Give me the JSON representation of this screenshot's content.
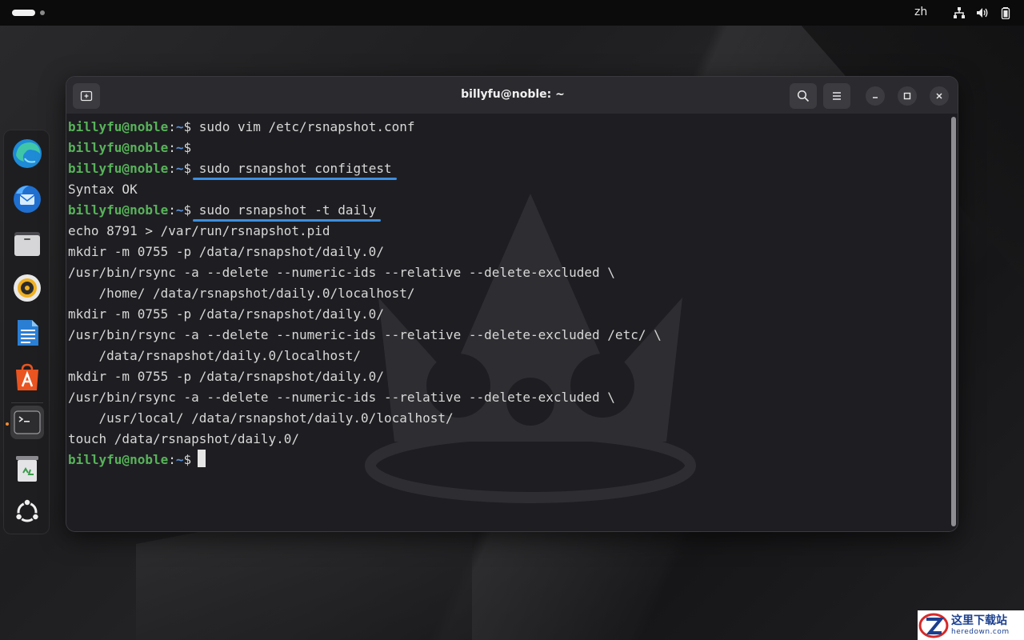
{
  "topbar": {
    "language": "zh",
    "icons": [
      "network-icon",
      "volume-icon",
      "battery-icon"
    ]
  },
  "dock": {
    "items": [
      {
        "name": "edge",
        "icon": "edge-browser-icon"
      },
      {
        "name": "thunderbird",
        "icon": "thunderbird-icon"
      },
      {
        "name": "files",
        "icon": "files-icon"
      },
      {
        "name": "rhythmbox",
        "icon": "rhythmbox-icon"
      },
      {
        "name": "writer",
        "icon": "libreoffice-writer-icon"
      },
      {
        "name": "app-center",
        "icon": "app-center-icon"
      },
      {
        "name": "terminal",
        "icon": "terminal-icon",
        "active": true
      },
      {
        "name": "trash",
        "icon": "trash-icon"
      },
      {
        "name": "show-apps",
        "icon": "ubuntu-logo-icon"
      }
    ]
  },
  "window": {
    "title": "billyfu@noble: ~",
    "colors": {
      "user": "#58b35a",
      "path": "#5a8fd8",
      "underline": "#3d8fe0"
    }
  },
  "terminal": {
    "prompt_user": "billyfu@noble",
    "prompt_colon": ":",
    "prompt_path": "~",
    "prompt_dollar": "$",
    "lines": [
      {
        "type": "prompt",
        "cmd": "sudo vim /etc/rsnapshot.conf"
      },
      {
        "type": "prompt",
        "cmd": ""
      },
      {
        "type": "prompt",
        "cmd": "sudo rsnapshot configtest",
        "highlight": true
      },
      {
        "type": "output",
        "text": "Syntax OK"
      },
      {
        "type": "prompt",
        "cmd": "sudo rsnapshot -t daily",
        "highlight": true
      },
      {
        "type": "output",
        "text": "echo 8791 > /var/run/rsnapshot.pid"
      },
      {
        "type": "output",
        "text": "mkdir -m 0755 -p /data/rsnapshot/daily.0/"
      },
      {
        "type": "output",
        "text": "/usr/bin/rsync -a --delete --numeric-ids --relative --delete-excluded \\"
      },
      {
        "type": "output",
        "text": "    /home/ /data/rsnapshot/daily.0/localhost/"
      },
      {
        "type": "output",
        "text": "mkdir -m 0755 -p /data/rsnapshot/daily.0/"
      },
      {
        "type": "output",
        "text": "/usr/bin/rsync -a --delete --numeric-ids --relative --delete-excluded /etc/ \\"
      },
      {
        "type": "output",
        "text": "    /data/rsnapshot/daily.0/localhost/"
      },
      {
        "type": "output",
        "text": "mkdir -m 0755 -p /data/rsnapshot/daily.0/"
      },
      {
        "type": "output",
        "text": "/usr/bin/rsync -a --delete --numeric-ids --relative --delete-excluded \\"
      },
      {
        "type": "output",
        "text": "    /usr/local/ /data/rsnapshot/daily.0/localhost/"
      },
      {
        "type": "output",
        "text": "touch /data/rsnapshot/daily.0/"
      },
      {
        "type": "prompt",
        "cmd": "",
        "cursor": true
      }
    ]
  },
  "site_badge": {
    "cn": "这里下载站",
    "en": "heredown.com"
  }
}
